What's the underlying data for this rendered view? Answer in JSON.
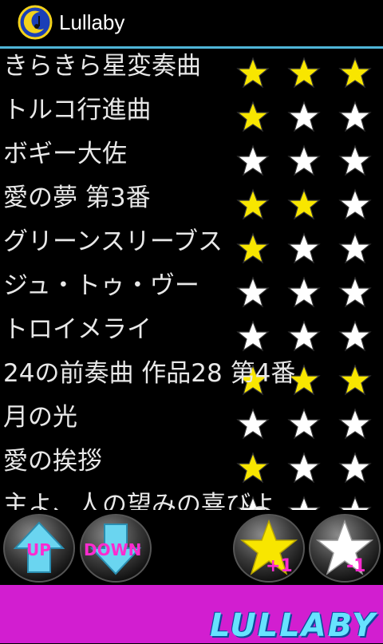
{
  "app": {
    "title": "Lullaby",
    "icon": "moon-music-icon",
    "accent": "#4fb5d8"
  },
  "songs": [
    {
      "title": "きらきら星変奏曲",
      "rating": 3
    },
    {
      "title": "トルコ行進曲",
      "rating": 1
    },
    {
      "title": "ボギー大佐",
      "rating": 0
    },
    {
      "title": "愛の夢 第3番",
      "rating": 2
    },
    {
      "title": "グリーンスリーブス",
      "rating": 1
    },
    {
      "title": "ジュ・トゥ・ヴー",
      "rating": 0
    },
    {
      "title": "トロイメライ",
      "rating": 0
    },
    {
      "title": "24の前奏曲 作品28 第4番",
      "rating": 3
    },
    {
      "title": "月の光",
      "rating": 0
    },
    {
      "title": "愛の挨拶",
      "rating": 1
    },
    {
      "title": "主よ、人の望みの喜びよ",
      "rating": 0
    }
  ],
  "star_colors": {
    "filled": "#f8e600",
    "empty": "#ffffff"
  },
  "controls": {
    "up_label": "UP",
    "down_label": "DOWN",
    "star_plus_label": "+1",
    "star_minus_label": "-1"
  },
  "banner": {
    "logo_text": "LULLABY",
    "color": "#d21ed0"
  }
}
